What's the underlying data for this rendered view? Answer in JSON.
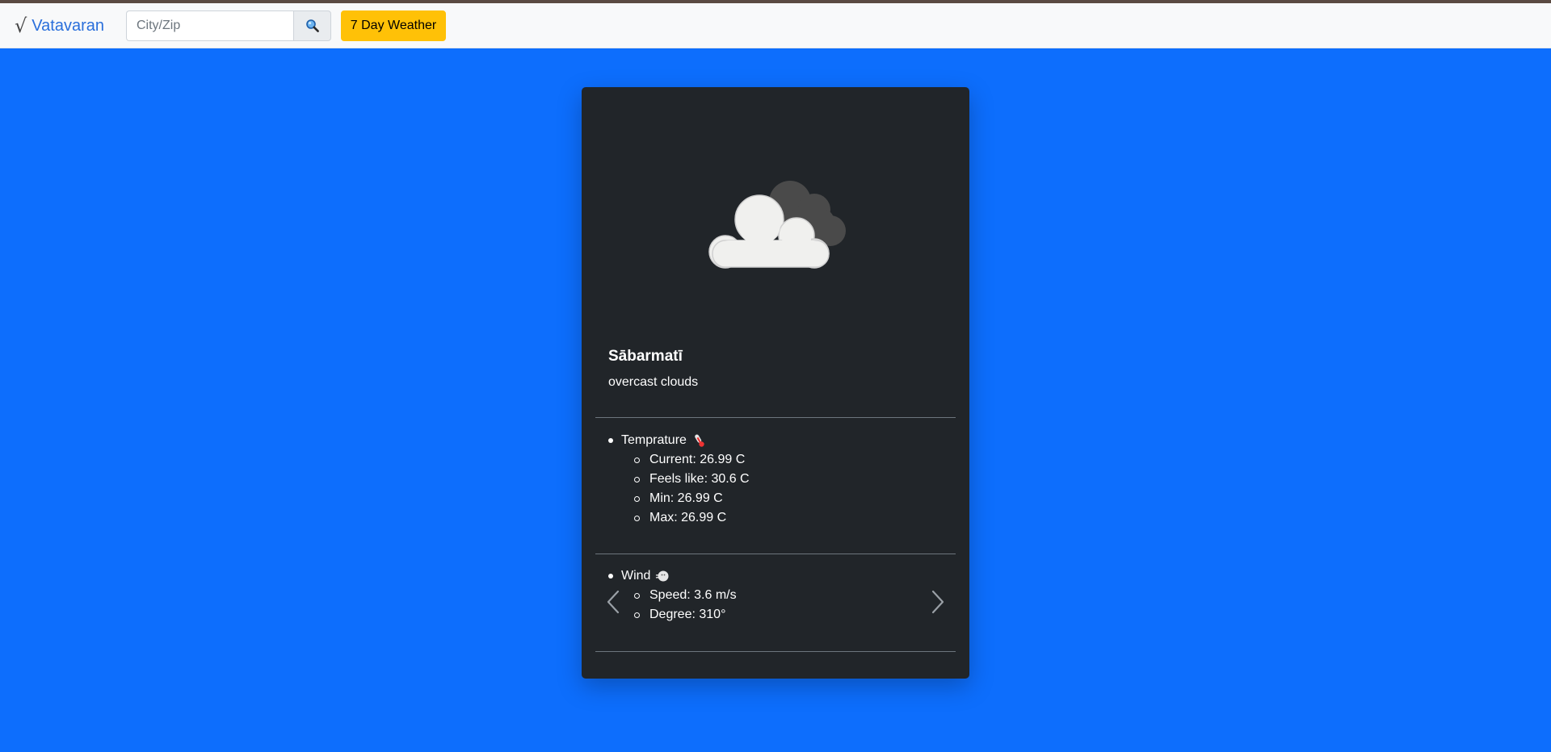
{
  "navbar": {
    "brand_icon": "√",
    "brand_name": "Vatavaran",
    "search_placeholder": "City/Zip",
    "search_value": "",
    "search_icon": "magnifier-icon",
    "week_button_label": "7 Day Weather"
  },
  "card": {
    "weather_icon": "overcast-clouds-icon",
    "city": "Sābarmatī",
    "description": "overcast clouds",
    "temperature": {
      "label": "Temprature",
      "icon": "thermometer-icon",
      "items": [
        "Current: 26.99 C",
        "Feels like: 30.6 C",
        "Min: 26.99 C",
        "Max: 26.99 C"
      ]
    },
    "wind": {
      "label": "Wind",
      "icon": "wind-face-icon",
      "items": [
        "Speed: 3.6 m/s",
        "Degree: 310°"
      ]
    }
  },
  "colors": {
    "background": "#0d6efd",
    "card": "#212529",
    "brand": "#2a6fdb",
    "button": "#ffc107"
  }
}
